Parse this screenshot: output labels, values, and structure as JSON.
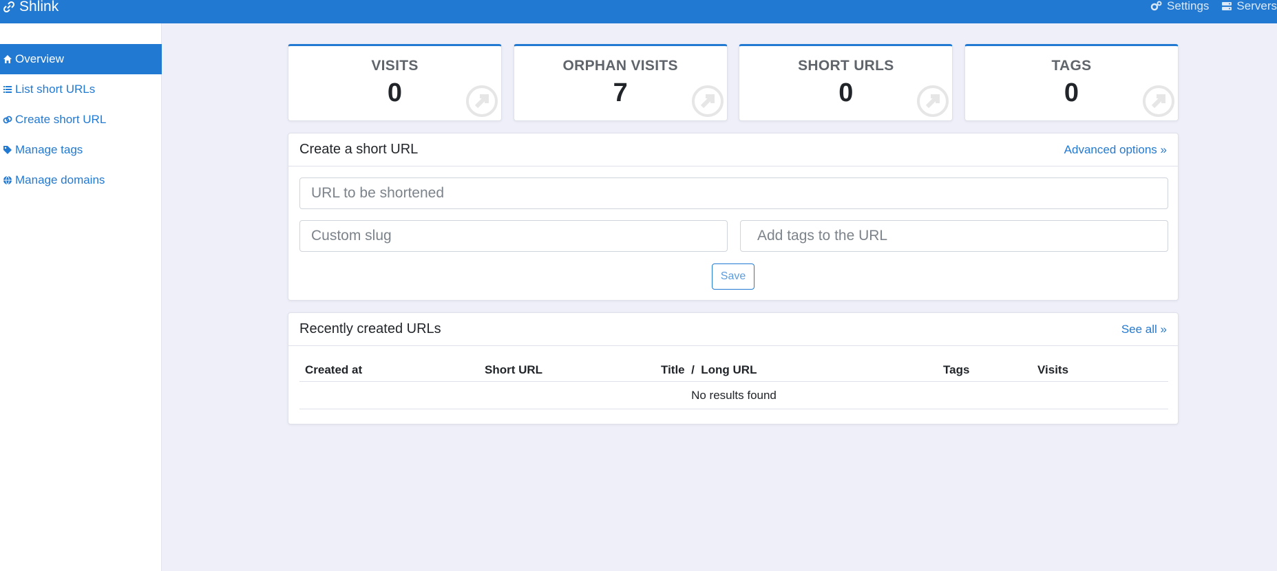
{
  "app": {
    "brand": "Shlink"
  },
  "topnav": {
    "settings": "Settings",
    "servers": "Servers"
  },
  "sidebar": {
    "items": [
      {
        "label": "Overview",
        "icon": "home-icon",
        "active": true
      },
      {
        "label": "List short URLs",
        "icon": "list-icon",
        "active": false
      },
      {
        "label": "Create short URL",
        "icon": "link-icon",
        "active": false
      },
      {
        "label": "Manage tags",
        "icon": "tags-icon",
        "active": false
      },
      {
        "label": "Manage domains",
        "icon": "globe-icon",
        "active": false
      }
    ]
  },
  "cards": [
    {
      "title": "VISITS",
      "value": "0"
    },
    {
      "title": "ORPHAN VISITS",
      "value": "7"
    },
    {
      "title": "SHORT URLS",
      "value": "0"
    },
    {
      "title": "TAGS",
      "value": "0"
    }
  ],
  "create": {
    "title": "Create a short URL",
    "advanced": "Advanced options »",
    "url_placeholder": "URL to be shortened",
    "slug_placeholder": "Custom slug",
    "tags_placeholder": "Add tags to the URL",
    "save": "Save"
  },
  "recent": {
    "title": "Recently created URLs",
    "see_all": "See all »",
    "columns": [
      "Created at",
      "Short URL",
      "Title  /  Long URL",
      "Tags",
      "Visits"
    ],
    "empty": "No results found"
  },
  "colors": {
    "primary": "#2279d1",
    "background": "#eeeff8"
  }
}
